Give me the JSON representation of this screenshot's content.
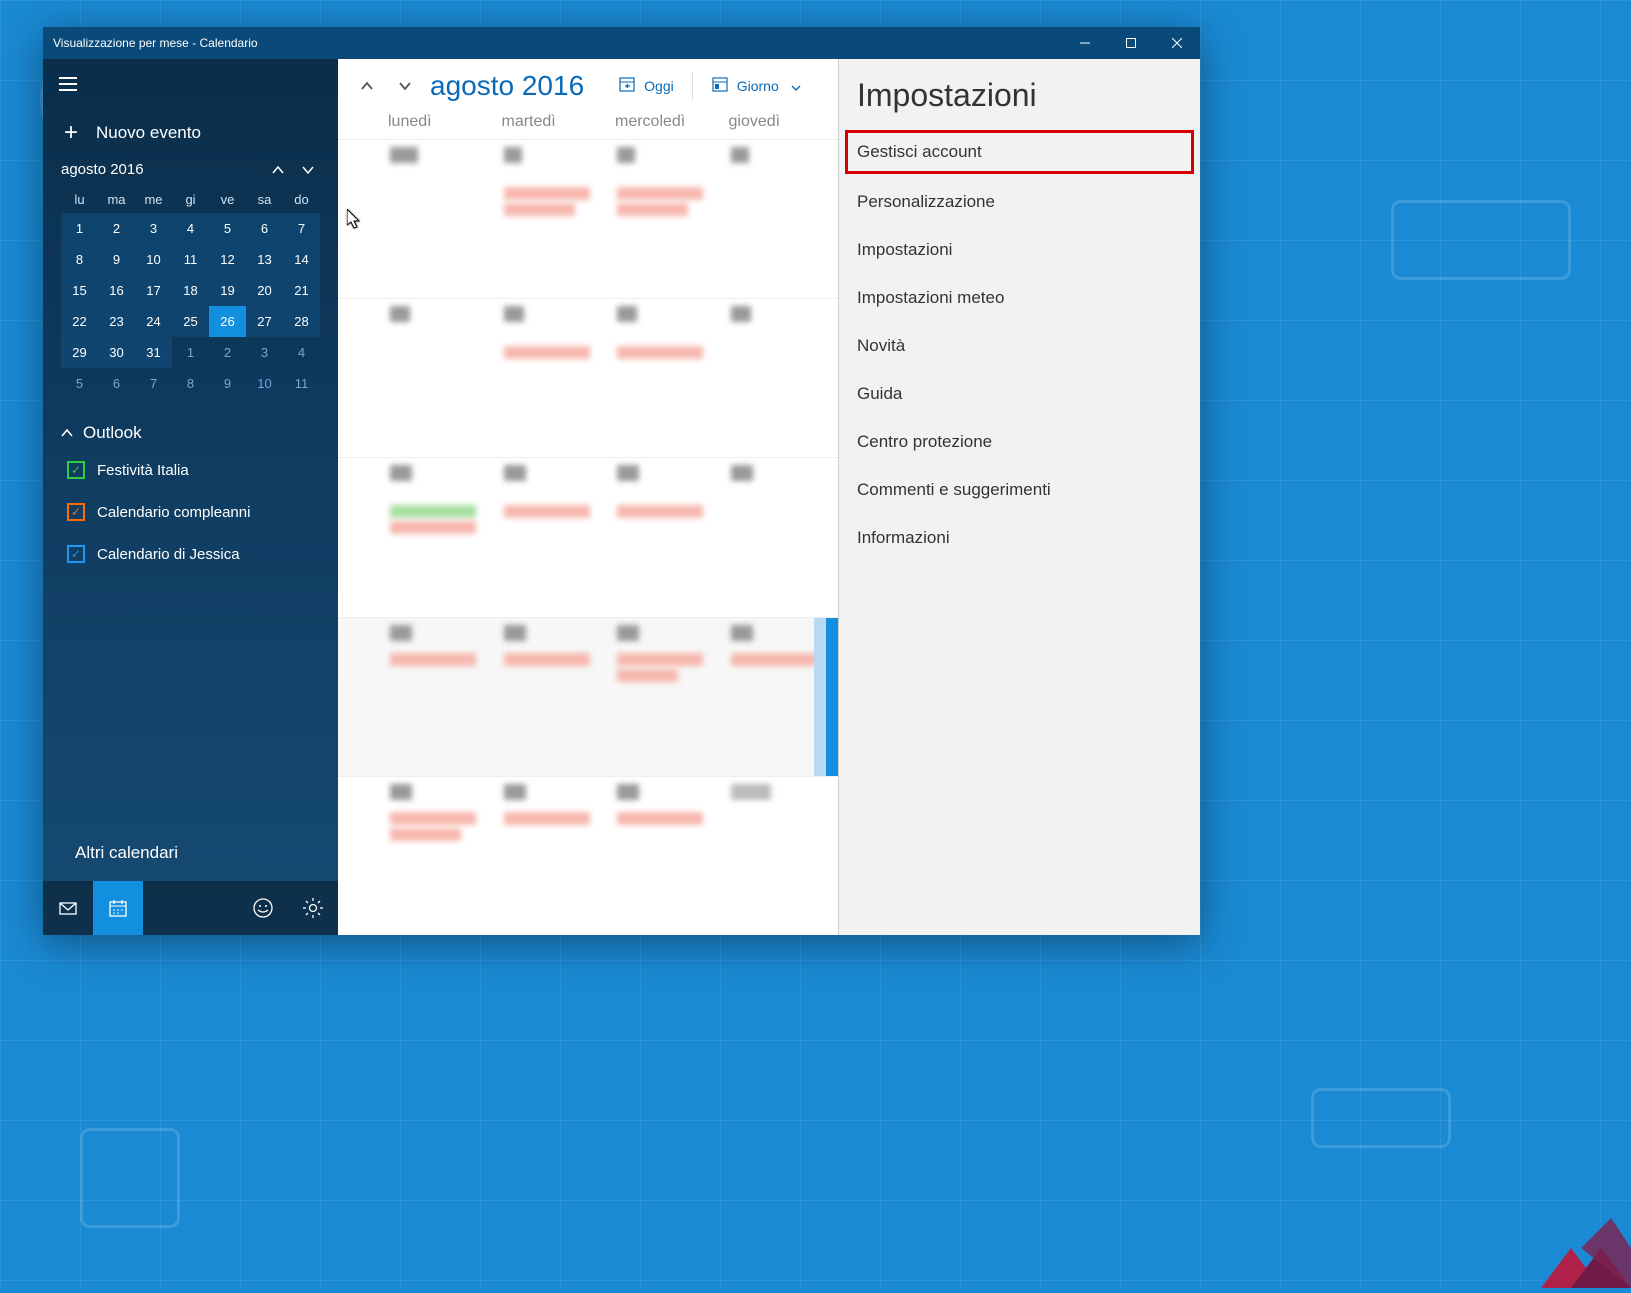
{
  "titlebar": {
    "title": "Visualizzazione per mese - Calendario"
  },
  "sidebar": {
    "new_event": "Nuovo evento",
    "month_label": "agosto 2016",
    "day_headers": [
      "lu",
      "ma",
      "me",
      "gi",
      "ve",
      "sa",
      "do"
    ],
    "days": [
      {
        "n": "1"
      },
      {
        "n": "2"
      },
      {
        "n": "3"
      },
      {
        "n": "4"
      },
      {
        "n": "5"
      },
      {
        "n": "6"
      },
      {
        "n": "7"
      },
      {
        "n": "8"
      },
      {
        "n": "9"
      },
      {
        "n": "10"
      },
      {
        "n": "11"
      },
      {
        "n": "12"
      },
      {
        "n": "13"
      },
      {
        "n": "14"
      },
      {
        "n": "15"
      },
      {
        "n": "16"
      },
      {
        "n": "17"
      },
      {
        "n": "18"
      },
      {
        "n": "19"
      },
      {
        "n": "20"
      },
      {
        "n": "21"
      },
      {
        "n": "22"
      },
      {
        "n": "23"
      },
      {
        "n": "24"
      },
      {
        "n": "25"
      },
      {
        "n": "26",
        "today": true
      },
      {
        "n": "27"
      },
      {
        "n": "28"
      },
      {
        "n": "29"
      },
      {
        "n": "30"
      },
      {
        "n": "31"
      },
      {
        "n": "1",
        "dim": true
      },
      {
        "n": "2",
        "dim": true
      },
      {
        "n": "3",
        "dim": true
      },
      {
        "n": "4",
        "dim": true
      },
      {
        "n": "5",
        "dim": true
      },
      {
        "n": "6",
        "dim": true
      },
      {
        "n": "7",
        "dim": true
      },
      {
        "n": "8",
        "dim": true
      },
      {
        "n": "9",
        "dim": true
      },
      {
        "n": "10",
        "dim": true
      },
      {
        "n": "11",
        "dim": true
      }
    ],
    "account_label": "Outlook",
    "calendars": [
      {
        "label": "Festività Italia",
        "color": "green"
      },
      {
        "label": "Calendario compleanni",
        "color": "orange"
      },
      {
        "label": "Calendario di Jessica",
        "color": "blue"
      }
    ],
    "other_calendars": "Altri calendari"
  },
  "toolbar": {
    "month": "agosto 2016",
    "today": "Oggi",
    "day": "Giorno"
  },
  "main_day_headers": [
    "lunedì",
    "martedì",
    "mercoledì",
    "giovedì"
  ],
  "settings": {
    "title": "Impostazioni",
    "items": [
      {
        "label": "Gestisci account",
        "highlight": true
      },
      {
        "label": "Personalizzazione"
      },
      {
        "label": "Impostazioni"
      },
      {
        "label": "Impostazioni meteo"
      },
      {
        "label": "Novità"
      },
      {
        "label": "Guida"
      },
      {
        "label": "Centro protezione"
      },
      {
        "label": "Commenti e suggerimenti"
      },
      {
        "label": "Informazioni"
      }
    ]
  }
}
